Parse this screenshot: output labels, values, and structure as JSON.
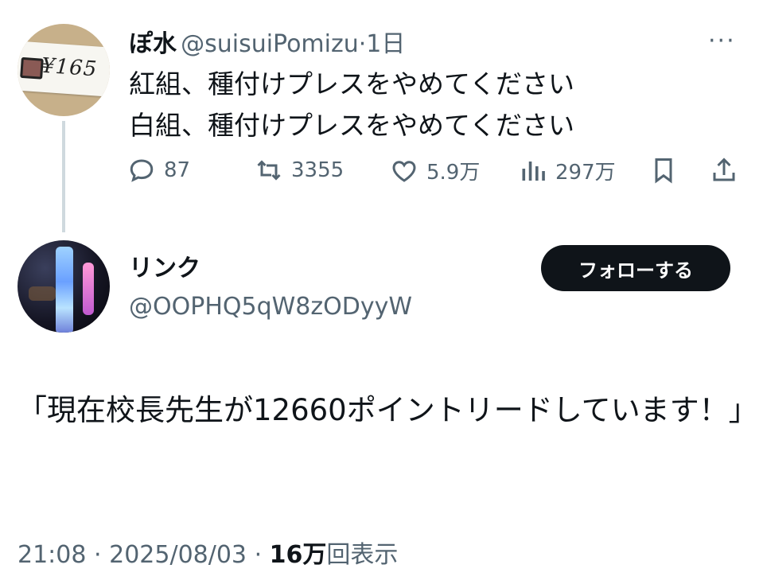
{
  "tweet": {
    "display_name": "ぽ水",
    "handle": "@suisuiPomizu",
    "separator": "·",
    "age": "1日",
    "more_label": "···",
    "avatar_text": "¥165",
    "lines": [
      "紅組、種付けプレスをやめてください",
      "白組、種付けプレスをやめてください"
    ],
    "actions": {
      "replies": "87",
      "retweets": "3355",
      "likes": "5.9万",
      "views": "297万"
    },
    "icons": [
      "reply-icon",
      "retweet-icon",
      "like-icon",
      "views-icon",
      "bookmark-icon",
      "share-icon"
    ]
  },
  "reply": {
    "display_name": "リンク",
    "handle": "@OOPHQ5qW8zODyyW",
    "follow_label": "フォローする",
    "text": "「現在校長先生が12660ポイントリードしています！」",
    "time": "21:08",
    "dot": "·",
    "date": "2025/08/03",
    "view_count": "16万",
    "view_suffix": "回表示"
  },
  "colors": {
    "text": "#0f1419",
    "secondary": "#536471",
    "button": "#0f1419",
    "thread": "#cfd9de"
  }
}
